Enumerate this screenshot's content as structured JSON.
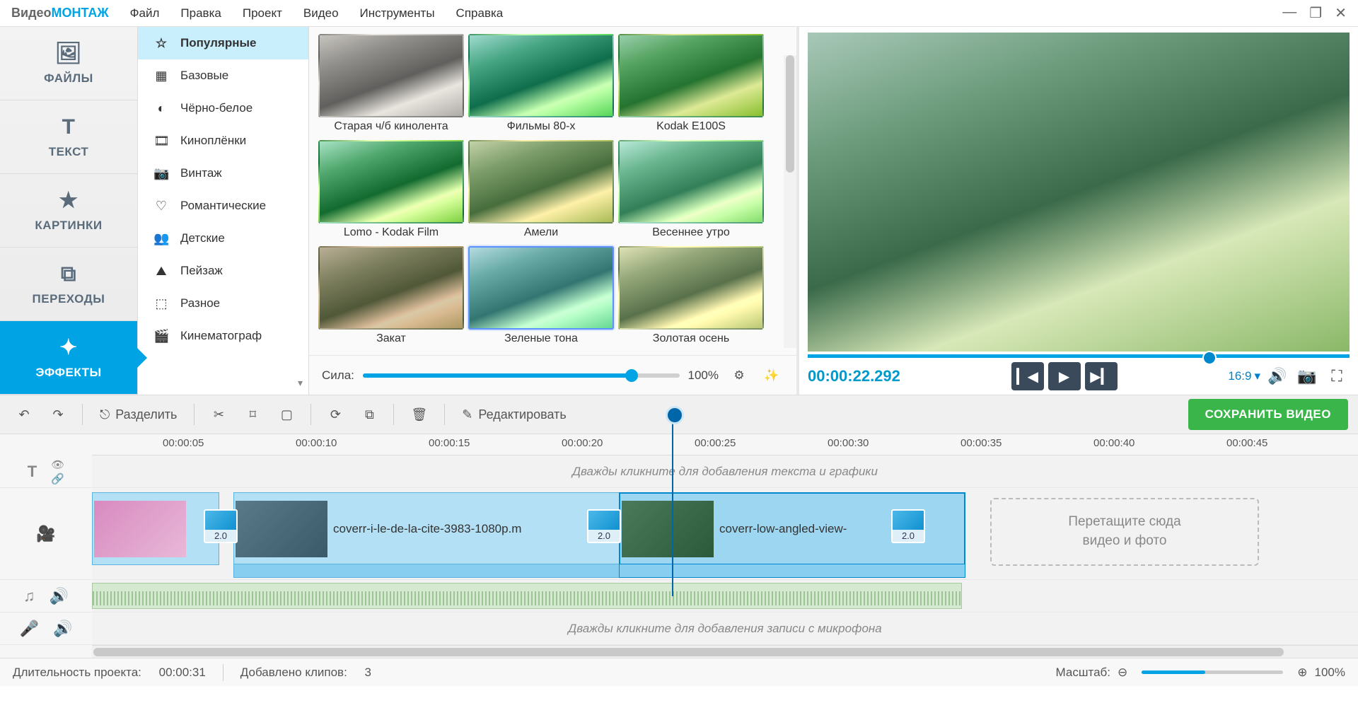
{
  "app": {
    "logo1": "Видео",
    "logo2": "МОНТАЖ"
  },
  "menu": [
    "Файл",
    "Правка",
    "Проект",
    "Видео",
    "Инструменты",
    "Справка"
  ],
  "side_tabs": [
    {
      "label": "ФАЙЛЫ"
    },
    {
      "label": "ТЕКСТ"
    },
    {
      "label": "КАРТИНКИ"
    },
    {
      "label": "ПЕРЕХОДЫ"
    },
    {
      "label": "ЭФФЕКТЫ"
    }
  ],
  "categories": [
    {
      "label": "Популярные"
    },
    {
      "label": "Базовые"
    },
    {
      "label": "Чёрно-белое"
    },
    {
      "label": "Киноплёнки"
    },
    {
      "label": "Винтаж"
    },
    {
      "label": "Романтические"
    },
    {
      "label": "Детские"
    },
    {
      "label": "Пейзаж"
    },
    {
      "label": "Разное"
    },
    {
      "label": "Кинематограф"
    }
  ],
  "effects": [
    {
      "label": "Старая ч/б кинолента",
      "cls": "thumb-bw"
    },
    {
      "label": "Фильмы 80-х",
      "cls": "thumb-80"
    },
    {
      "label": "Kodak E100S",
      "cls": "thumb-kodak"
    },
    {
      "label": "Lomo - Kodak Film",
      "cls": "thumb-lomo"
    },
    {
      "label": "Амели",
      "cls": "thumb-amelie"
    },
    {
      "label": "Весеннее утро",
      "cls": "thumb-spring"
    },
    {
      "label": "Закат",
      "cls": "thumb-sunset"
    },
    {
      "label": "Зеленые тона",
      "cls": "thumb-green"
    },
    {
      "label": "Золотая осень",
      "cls": "thumb-autumn"
    }
  ],
  "strength": {
    "label": "Сила:",
    "value": "100%"
  },
  "preview": {
    "timecode": "00:00:22.292",
    "ratio": "16:9"
  },
  "toolbar": {
    "split": "Разделить",
    "edit": "Редактировать",
    "save": "СОХРАНИТЬ ВИДЕО"
  },
  "ruler": [
    "00:00:05",
    "00:00:10",
    "00:00:15",
    "00:00:20",
    "00:00:25",
    "00:00:30",
    "00:00:35",
    "00:00:40",
    "00:00:45"
  ],
  "tracks": {
    "text_hint": "Дважды кликните для добавления текста и графики",
    "mic_hint": "Дважды кликните для добавления записи с микрофона",
    "clip1": "coverr-i-le-de-la-cite-3983-1080p.m",
    "clip2": "coverr-low-angled-view-",
    "drop_line1": "Перетащите сюда",
    "drop_line2": "видео и фото",
    "trans_dur": "2.0"
  },
  "status": {
    "dur_lbl": "Длительность проекта:",
    "dur_val": "00:00:31",
    "clips_lbl": "Добавлено клипов:",
    "clips_val": "3",
    "zoom_lbl": "Масштаб:",
    "zoom_val": "100%"
  }
}
